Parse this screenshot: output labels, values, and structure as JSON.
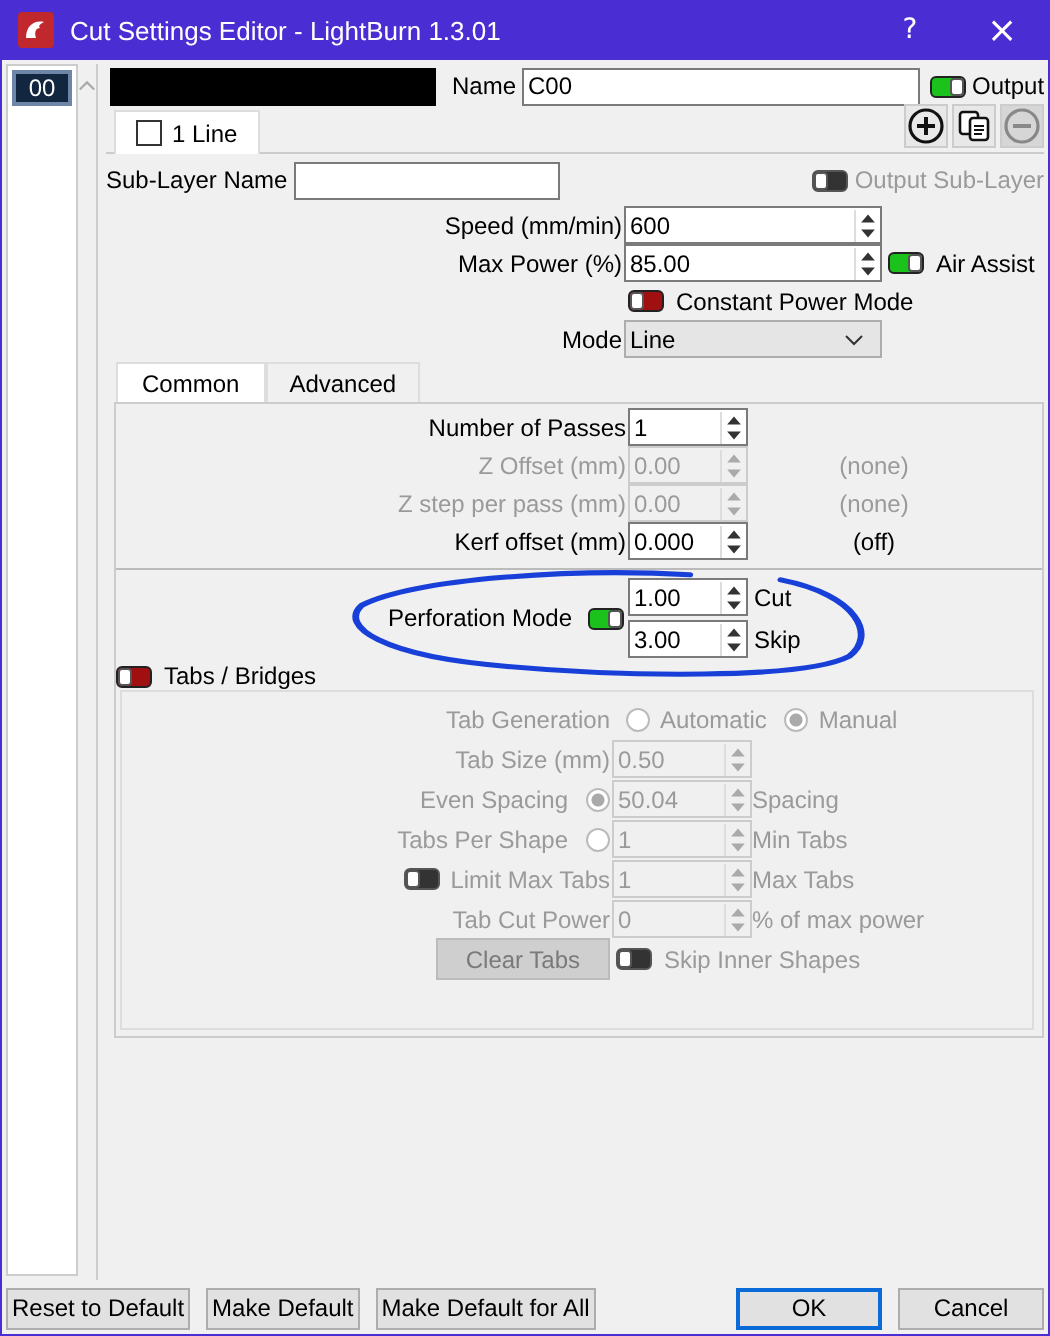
{
  "window": {
    "title": "Cut Settings Editor - LightBurn 1.3.01",
    "help_button": "?",
    "close_button": "×"
  },
  "layers": [
    {
      "label": "00",
      "selected": true
    }
  ],
  "layer": {
    "name_label": "Name",
    "name_value": "C00",
    "output": {
      "label": "Output",
      "on": true,
      "disabled": false
    }
  },
  "sublayer_tabs": [
    {
      "label": "1 Line",
      "selected": true,
      "checked": false
    }
  ],
  "sublayer": {
    "name_label": "Sub-Layer Name",
    "output": {
      "label": "Output Sub-Layer",
      "on": false,
      "disabled": true
    }
  },
  "speed": {
    "label": "Speed (mm/min)",
    "value": "600"
  },
  "max_power": {
    "label": "Max Power (%)",
    "value": "85.00"
  },
  "air_assist": {
    "label": "Air Assist",
    "on": true,
    "disabled": false
  },
  "constant_power": {
    "label": "Constant Power Mode",
    "on": false,
    "disabled": false
  },
  "mode": {
    "label": "Mode",
    "value": "Line"
  },
  "settings_tabs": [
    {
      "label": "Common",
      "selected": true
    },
    {
      "label": "Advanced",
      "selected": false
    }
  ],
  "common": [
    {
      "label": "Number of Passes",
      "value": "1",
      "disabled": false
    },
    {
      "label": "Z Offset (mm)",
      "value": "0.00",
      "disabled": true,
      "note": "(none)"
    },
    {
      "label": "Z step per pass (mm)",
      "value": "0.00",
      "disabled": true,
      "note": "(none)"
    },
    {
      "label": "Kerf offset (mm)",
      "value": "0.000",
      "disabled": false,
      "note": "(off)"
    }
  ],
  "perforation": {
    "label": "Perforation Mode",
    "on": true,
    "fields": [
      {
        "value": "1.00",
        "suffix": "Cut"
      },
      {
        "value": "3.00",
        "suffix": "Skip"
      }
    ]
  },
  "tabs_bridges": {
    "label": "Tabs / Bridges",
    "on": false,
    "rows": [
      {
        "kind": "radios",
        "label": "Tab Generation",
        "options": [
          {
            "label": "Automatic",
            "selected": false
          },
          {
            "label": "Manual",
            "selected": true
          }
        ]
      },
      {
        "kind": "field",
        "label": "Tab Size (mm)",
        "value": "0.50"
      },
      {
        "kind": "radio_field",
        "label": "Even Spacing",
        "selected": true,
        "value": "50.04",
        "suffix": "Spacing"
      },
      {
        "kind": "radio_field",
        "label": "Tabs Per Shape",
        "selected": false,
        "value": "1",
        "suffix": "Min Tabs"
      },
      {
        "kind": "toggle_field",
        "label": "Limit Max Tabs",
        "on": false,
        "value": "1",
        "suffix": "Max Tabs"
      },
      {
        "kind": "field",
        "label": "Tab Cut Power",
        "value": "0",
        "suffix": "% of max power"
      },
      {
        "kind": "button_toggle",
        "button": "Clear Tabs",
        "toggle_label": "Skip Inner Shapes",
        "on": false
      }
    ]
  },
  "left_buttons": [
    {
      "label": "Reset to Default",
      "default": false
    },
    {
      "label": "Make Default",
      "default": false
    },
    {
      "label": "Make Default for All",
      "default": false
    }
  ],
  "right_buttons": [
    {
      "label": "OK",
      "default": true
    },
    {
      "label": "Cancel",
      "default": false
    }
  ]
}
